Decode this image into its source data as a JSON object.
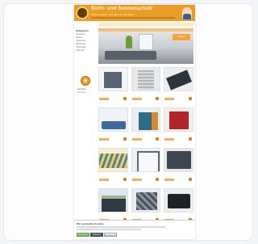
{
  "header": {
    "brand": "Sicht- und Sonnenschutz",
    "tagline": "Plissee, Rollos, Jalousien und Markisen"
  },
  "sidebar": {
    "title": "Kategorien",
    "items": [
      "Plissees",
      "Rollos",
      "Jalousien",
      "Markisen",
      "Vorhänge",
      "Zubehör"
    ],
    "badge_caption": "Service",
    "badge_sub": "Beratung"
  },
  "hero": {
    "badge": "Angebot"
  },
  "products": [
    {
      "icon": "blind-product-icon"
    },
    {
      "icon": "blind-product-icon"
    },
    {
      "icon": "blind-product-icon"
    },
    {
      "icon": "blind-product-icon"
    },
    {
      "icon": "blind-product-icon"
    },
    {
      "icon": "blind-product-icon"
    },
    {
      "icon": "blind-product-icon"
    },
    {
      "icon": "blind-product-icon"
    },
    {
      "icon": "blind-product-icon"
    },
    {
      "icon": "blind-product-icon"
    },
    {
      "icon": "blind-product-icon"
    },
    {
      "icon": "blind-product-icon"
    }
  ],
  "cookie_banner": {
    "title": "Wir verwenden Cookies",
    "accept_label": "Akzeptieren",
    "reject_label": "Ablehnen",
    "settings_label": "Einstellungen"
  },
  "colors": {
    "accent": "#e99c28",
    "accept": "#6aa84f"
  }
}
